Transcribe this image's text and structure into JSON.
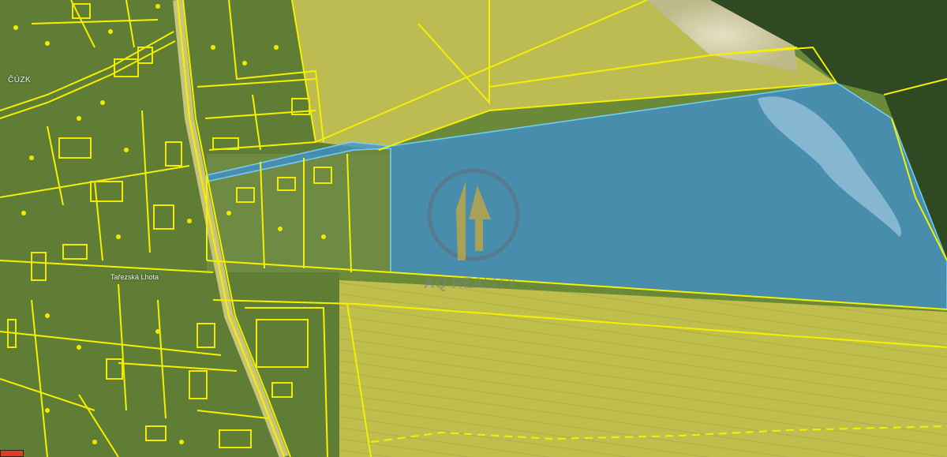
{
  "map": {
    "source_label": "ČÚZK",
    "place_label": "Tařezská Lhota",
    "watermark": {
      "brand": "AQ",
      "suffix": " REALITY"
    },
    "colors": {
      "parcel_line": "#f5f000",
      "highlight_fill": "#3c8fd8",
      "highlight_stroke": "#6fd0ff",
      "building": "#f3ea00",
      "field": "#b9b94a",
      "field_light": "#cfc35a",
      "forest": "#2f4a22",
      "village_green": "#5f7d34",
      "road": "#c8c27a"
    },
    "icons": [
      "logo-icon",
      "scale-bar-icon"
    ]
  }
}
